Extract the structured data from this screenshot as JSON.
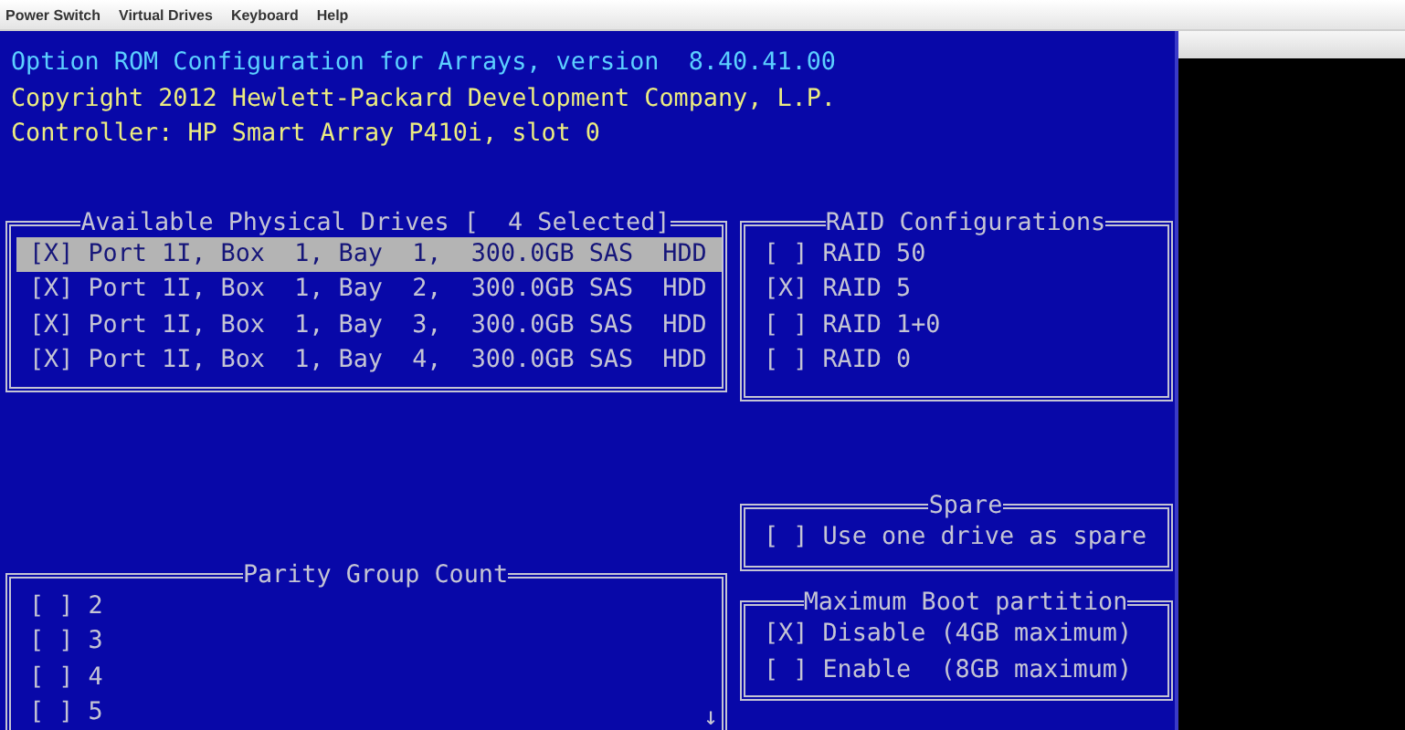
{
  "menu_bar": {
    "items": [
      "Power Switch",
      "Virtual Drives",
      "Keyboard",
      "Help"
    ]
  },
  "header": {
    "title": "Option ROM Configuration for Arrays, version  8.40.41.00",
    "copyright": "Copyright 2012 Hewlett-Packard Development Company, L.P.",
    "controller": "Controller: HP Smart Array P410i, slot 0"
  },
  "physical_drives": {
    "title": "Available Physical Drives [  4 Selected]",
    "items": [
      {
        "box": "[X]",
        "label": "Port 1I, Box  1, Bay  1,  300.0GB SAS  HDD",
        "selected": true
      },
      {
        "box": "[X]",
        "label": "Port 1I, Box  1, Bay  2,  300.0GB SAS  HDD",
        "selected": false
      },
      {
        "box": "[X]",
        "label": "Port 1I, Box  1, Bay  3,  300.0GB SAS  HDD",
        "selected": false
      },
      {
        "box": "[X]",
        "label": "Port 1I, Box  1, Bay  4,  300.0GB SAS  HDD",
        "selected": false
      }
    ]
  },
  "raid_configurations": {
    "title": "RAID Configurations",
    "items": [
      {
        "box": "[ ]",
        "label": "RAID 50"
      },
      {
        "box": "[X]",
        "label": "RAID 5"
      },
      {
        "box": "[ ]",
        "label": "RAID 1+0"
      },
      {
        "box": "[ ]",
        "label": "RAID 0"
      }
    ]
  },
  "spare": {
    "title": "Spare",
    "items": [
      {
        "box": "[ ]",
        "label": "Use one drive as spare"
      }
    ]
  },
  "parity_group_count": {
    "title": "Parity Group Count",
    "scroll_arrow": "↓",
    "items": [
      {
        "box": "[ ]",
        "label": "2"
      },
      {
        "box": "[ ]",
        "label": "3"
      },
      {
        "box": "[ ]",
        "label": "4"
      },
      {
        "box": "[ ]",
        "label": "5"
      }
    ]
  },
  "maximum_boot_partition": {
    "title": "Maximum Boot partition",
    "items": [
      {
        "box": "[X]",
        "label": "Disable (4GB maximum)"
      },
      {
        "box": "[ ]",
        "label": "Enable  (8GB maximum)"
      }
    ]
  }
}
